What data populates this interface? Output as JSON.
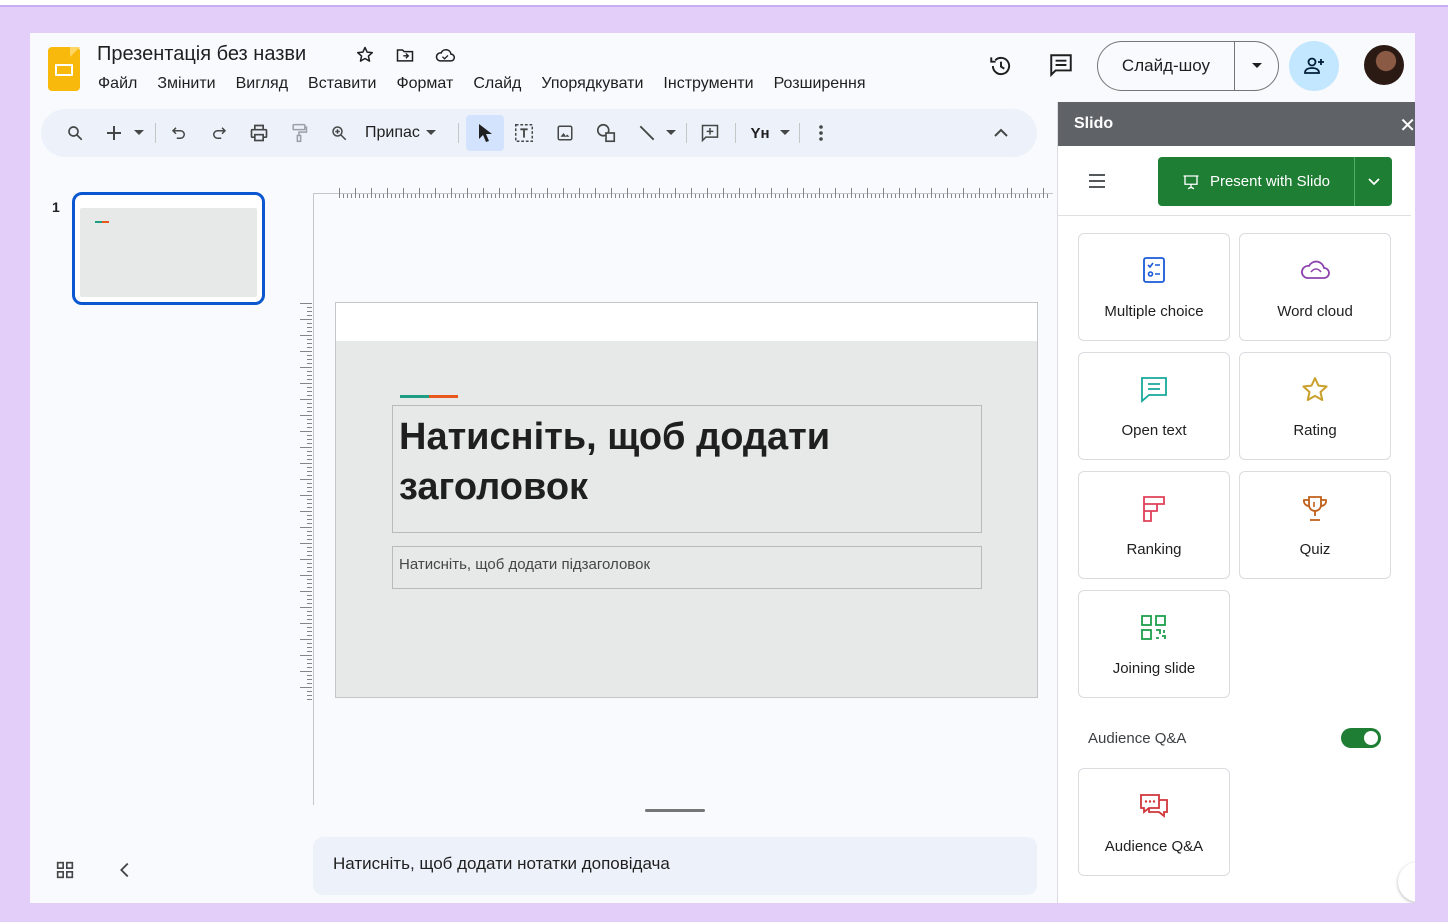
{
  "header": {
    "doc_title": "Презентація без назви",
    "menu": [
      "Файл",
      "Змінити",
      "Вигляд",
      "Вставити",
      "Формат",
      "Слайд",
      "Упорядкувати",
      "Інструменти",
      "Розширення"
    ],
    "slideshow_label": "Слайд-шоу"
  },
  "toolbar": {
    "zoom_label": "Припас",
    "text_style_label": "Yн"
  },
  "filmstrip": {
    "slide_number": "1"
  },
  "slide": {
    "title_placeholder_line1": "Натисніть, щоб додати",
    "title_placeholder_line2": "заголовок",
    "subtitle_placeholder": "Натисніть, щоб додати підзаголовок",
    "accent_colors": [
      "#1e9e83",
      "#e8581c"
    ]
  },
  "notes": {
    "placeholder": "Натисніть, щоб додати нотатки доповідача"
  },
  "slido": {
    "title": "Slido",
    "present_label": "Present with Slido",
    "cards": [
      {
        "label": "Multiple choice",
        "icon": "checklist-icon"
      },
      {
        "label": "Word cloud",
        "icon": "cloud-icon"
      },
      {
        "label": "Open text",
        "icon": "chat-text-icon"
      },
      {
        "label": "Rating",
        "icon": "star-icon"
      },
      {
        "label": "Ranking",
        "icon": "ranking-icon"
      },
      {
        "label": "Quiz",
        "icon": "trophy-icon"
      },
      {
        "label": "Joining slide",
        "icon": "qr-code-icon"
      }
    ],
    "qa_toggle_label": "Audience Q&A",
    "qa_toggle_on": true,
    "qa_card_label": "Audience Q&A",
    "brand_green": "#1e7e34"
  }
}
